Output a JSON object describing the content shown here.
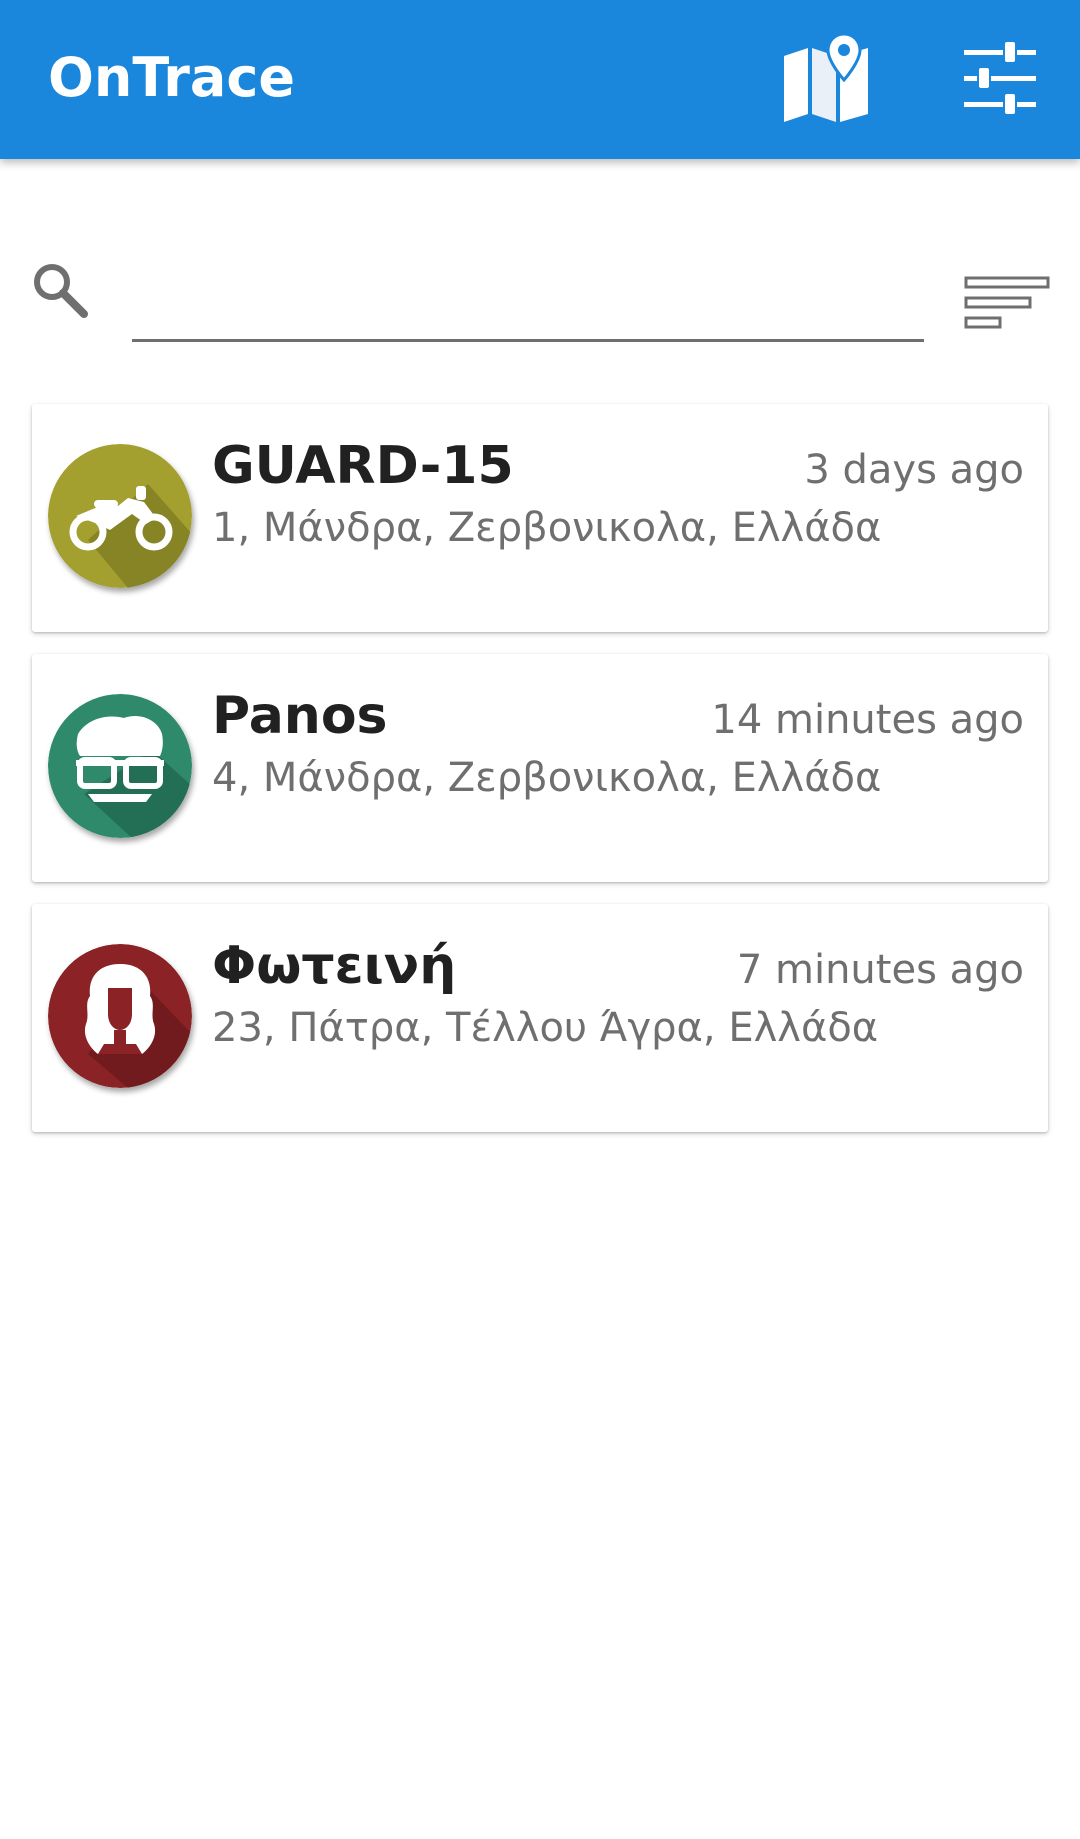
{
  "appbar": {
    "title": "OnTrace",
    "background_color": "#1a86dc",
    "map_icon": "map-pin-icon",
    "settings_icon": "sliders-icon"
  },
  "search": {
    "icon": "search-icon",
    "value": "",
    "placeholder": "",
    "sort_icon": "sort-lines-icon"
  },
  "devices": [
    {
      "name": "GUARD-15",
      "time": "3 days ago",
      "address": "1, Μάνδρα, Ζερβονικολα, Ελλάδα",
      "avatar": "motorcycle-icon",
      "avatar_color": "#a3a02f"
    },
    {
      "name": "Panos",
      "time": "14 minutes ago",
      "address": "4, Μάνδρα, Ζερβονικολα, Ελλάδα",
      "avatar": "man-glasses-icon",
      "avatar_color": "#2e8a6b"
    },
    {
      "name": "Φωτεινή",
      "time": "7 minutes ago",
      "address": "23, Πάτρα, Τέλλου Άγρα, Ελλάδα",
      "avatar": "woman-icon",
      "avatar_color": "#8a2226"
    }
  ]
}
